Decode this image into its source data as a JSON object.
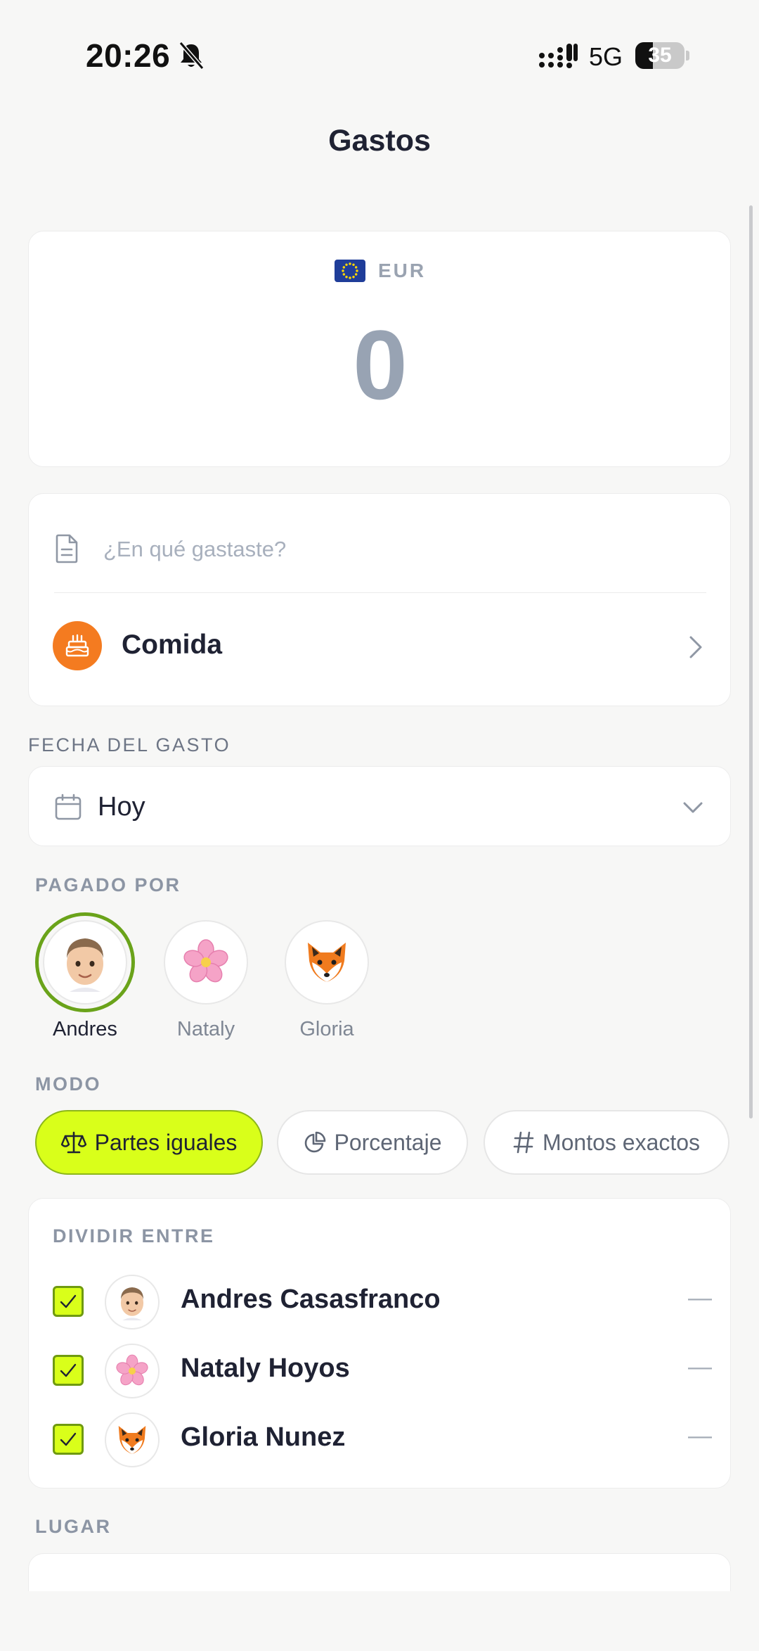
{
  "status_bar": {
    "time": "20:26",
    "network": "5G",
    "battery_percent": "35",
    "battery_level": 0.35
  },
  "header": {
    "title": "Gastos"
  },
  "amount_card": {
    "currency_flag": "eu-flag-icon",
    "currency_code": "EUR",
    "amount": "0"
  },
  "description": {
    "placeholder": "¿En qué gastaste?",
    "value": ""
  },
  "category": {
    "icon": "cake-icon",
    "icon_color": "#f47b20",
    "label": "Comida"
  },
  "date_section": {
    "label": "FECHA DEL GASTO",
    "value": "Hoy"
  },
  "paid_by": {
    "label": "PAGADO POR",
    "selected_ring_color": "#6aa31a",
    "payers": [
      {
        "name": "Andres",
        "avatar": "memoji-avatar",
        "selected": true
      },
      {
        "name": "Nataly",
        "avatar": "cherry-blossom-avatar",
        "selected": false
      },
      {
        "name": "Gloria",
        "avatar": "fox-avatar",
        "selected": false
      }
    ]
  },
  "mode": {
    "label": "MODO",
    "accent": "#d9ff1a",
    "options": [
      {
        "label": "Partes iguales",
        "icon": "scale-icon",
        "active": true
      },
      {
        "label": "Porcentaje",
        "icon": "pie-chart-icon",
        "active": false
      },
      {
        "label": "Montos exactos",
        "icon": "hash-icon",
        "active": false
      }
    ]
  },
  "split": {
    "label": "DIVIDIR ENTRE",
    "members": [
      {
        "name": "Andres Casasfranco",
        "avatar": "memoji-avatar",
        "checked": true,
        "amount": "—"
      },
      {
        "name": "Nataly Hoyos",
        "avatar": "cherry-blossom-avatar",
        "checked": true,
        "amount": "—"
      },
      {
        "name": "Gloria Nunez",
        "avatar": "fox-avatar",
        "checked": true,
        "amount": "—"
      }
    ]
  },
  "place": {
    "label": "LUGAR"
  }
}
